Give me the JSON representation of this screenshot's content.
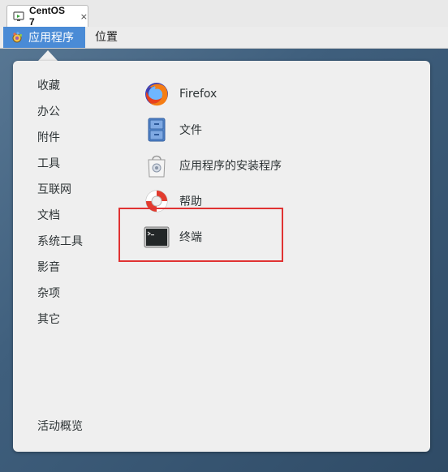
{
  "vm_tab": {
    "label": "CentOS 7",
    "close": "×"
  },
  "topbar": {
    "applications": "应用程序",
    "places": "位置"
  },
  "categories": [
    "收藏",
    "办公",
    "附件",
    "工具",
    "互联网",
    "文档",
    "系统工具",
    "影音",
    "杂项",
    "其它"
  ],
  "activities": "活动概览",
  "apps": [
    {
      "label": "Firefox",
      "icon": "firefox-icon"
    },
    {
      "label": "文件",
      "icon": "files-icon"
    },
    {
      "label": "应用程序的安装程序",
      "icon": "software-installer-icon"
    },
    {
      "label": "帮助",
      "icon": "help-lifebuoy-icon"
    },
    {
      "label": "终端",
      "icon": "terminal-icon"
    }
  ],
  "colors": {
    "highlight": "#e03232",
    "accent": "#4a8bd6"
  }
}
